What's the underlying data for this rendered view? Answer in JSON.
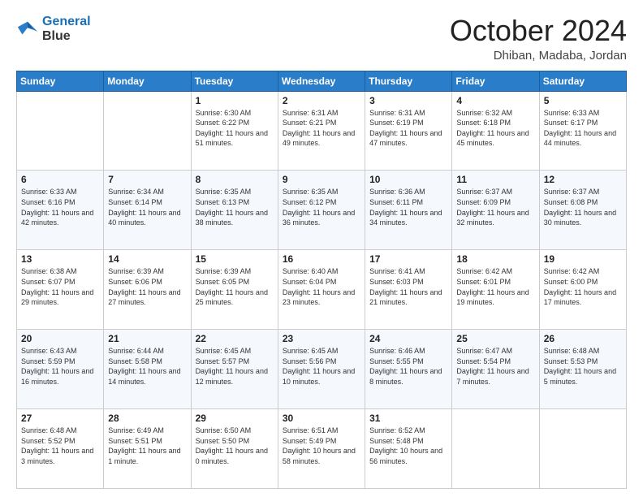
{
  "logo": {
    "line1": "General",
    "line2": "Blue"
  },
  "header": {
    "month": "October 2024",
    "location": "Dhiban, Madaba, Jordan"
  },
  "weekdays": [
    "Sunday",
    "Monday",
    "Tuesday",
    "Wednesday",
    "Thursday",
    "Friday",
    "Saturday"
  ],
  "weeks": [
    [
      {
        "day": "",
        "info": ""
      },
      {
        "day": "",
        "info": ""
      },
      {
        "day": "1",
        "info": "Sunrise: 6:30 AM\nSunset: 6:22 PM\nDaylight: 11 hours and 51 minutes."
      },
      {
        "day": "2",
        "info": "Sunrise: 6:31 AM\nSunset: 6:21 PM\nDaylight: 11 hours and 49 minutes."
      },
      {
        "day": "3",
        "info": "Sunrise: 6:31 AM\nSunset: 6:19 PM\nDaylight: 11 hours and 47 minutes."
      },
      {
        "day": "4",
        "info": "Sunrise: 6:32 AM\nSunset: 6:18 PM\nDaylight: 11 hours and 45 minutes."
      },
      {
        "day": "5",
        "info": "Sunrise: 6:33 AM\nSunset: 6:17 PM\nDaylight: 11 hours and 44 minutes."
      }
    ],
    [
      {
        "day": "6",
        "info": "Sunrise: 6:33 AM\nSunset: 6:16 PM\nDaylight: 11 hours and 42 minutes."
      },
      {
        "day": "7",
        "info": "Sunrise: 6:34 AM\nSunset: 6:14 PM\nDaylight: 11 hours and 40 minutes."
      },
      {
        "day": "8",
        "info": "Sunrise: 6:35 AM\nSunset: 6:13 PM\nDaylight: 11 hours and 38 minutes."
      },
      {
        "day": "9",
        "info": "Sunrise: 6:35 AM\nSunset: 6:12 PM\nDaylight: 11 hours and 36 minutes."
      },
      {
        "day": "10",
        "info": "Sunrise: 6:36 AM\nSunset: 6:11 PM\nDaylight: 11 hours and 34 minutes."
      },
      {
        "day": "11",
        "info": "Sunrise: 6:37 AM\nSunset: 6:09 PM\nDaylight: 11 hours and 32 minutes."
      },
      {
        "day": "12",
        "info": "Sunrise: 6:37 AM\nSunset: 6:08 PM\nDaylight: 11 hours and 30 minutes."
      }
    ],
    [
      {
        "day": "13",
        "info": "Sunrise: 6:38 AM\nSunset: 6:07 PM\nDaylight: 11 hours and 29 minutes."
      },
      {
        "day": "14",
        "info": "Sunrise: 6:39 AM\nSunset: 6:06 PM\nDaylight: 11 hours and 27 minutes."
      },
      {
        "day": "15",
        "info": "Sunrise: 6:39 AM\nSunset: 6:05 PM\nDaylight: 11 hours and 25 minutes."
      },
      {
        "day": "16",
        "info": "Sunrise: 6:40 AM\nSunset: 6:04 PM\nDaylight: 11 hours and 23 minutes."
      },
      {
        "day": "17",
        "info": "Sunrise: 6:41 AM\nSunset: 6:03 PM\nDaylight: 11 hours and 21 minutes."
      },
      {
        "day": "18",
        "info": "Sunrise: 6:42 AM\nSunset: 6:01 PM\nDaylight: 11 hours and 19 minutes."
      },
      {
        "day": "19",
        "info": "Sunrise: 6:42 AM\nSunset: 6:00 PM\nDaylight: 11 hours and 17 minutes."
      }
    ],
    [
      {
        "day": "20",
        "info": "Sunrise: 6:43 AM\nSunset: 5:59 PM\nDaylight: 11 hours and 16 minutes."
      },
      {
        "day": "21",
        "info": "Sunrise: 6:44 AM\nSunset: 5:58 PM\nDaylight: 11 hours and 14 minutes."
      },
      {
        "day": "22",
        "info": "Sunrise: 6:45 AM\nSunset: 5:57 PM\nDaylight: 11 hours and 12 minutes."
      },
      {
        "day": "23",
        "info": "Sunrise: 6:45 AM\nSunset: 5:56 PM\nDaylight: 11 hours and 10 minutes."
      },
      {
        "day": "24",
        "info": "Sunrise: 6:46 AM\nSunset: 5:55 PM\nDaylight: 11 hours and 8 minutes."
      },
      {
        "day": "25",
        "info": "Sunrise: 6:47 AM\nSunset: 5:54 PM\nDaylight: 11 hours and 7 minutes."
      },
      {
        "day": "26",
        "info": "Sunrise: 6:48 AM\nSunset: 5:53 PM\nDaylight: 11 hours and 5 minutes."
      }
    ],
    [
      {
        "day": "27",
        "info": "Sunrise: 6:48 AM\nSunset: 5:52 PM\nDaylight: 11 hours and 3 minutes."
      },
      {
        "day": "28",
        "info": "Sunrise: 6:49 AM\nSunset: 5:51 PM\nDaylight: 11 hours and 1 minute."
      },
      {
        "day": "29",
        "info": "Sunrise: 6:50 AM\nSunset: 5:50 PM\nDaylight: 11 hours and 0 minutes."
      },
      {
        "day": "30",
        "info": "Sunrise: 6:51 AM\nSunset: 5:49 PM\nDaylight: 10 hours and 58 minutes."
      },
      {
        "day": "31",
        "info": "Sunrise: 6:52 AM\nSunset: 5:48 PM\nDaylight: 10 hours and 56 minutes."
      },
      {
        "day": "",
        "info": ""
      },
      {
        "day": "",
        "info": ""
      }
    ]
  ]
}
